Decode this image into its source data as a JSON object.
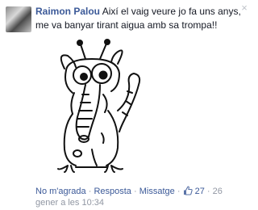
{
  "comment": {
    "author": "Raimon Palou",
    "text": "Així el vaig veure jo fa uns anys, me va banyar tirant aigua amb sa trompa!!",
    "close_symbol": "×"
  },
  "actions": {
    "unlike": "No m'agrada",
    "reply": "Resposta",
    "message": "Missatge",
    "like_count": "27",
    "date_part": "26",
    "timestamp": "gener a les 10:34",
    "separator": "·"
  },
  "icons": {
    "close": "close-icon",
    "like": "thumbs-up-icon"
  },
  "colors": {
    "link": "#3b5998",
    "meta": "#9197a3",
    "text": "#141823"
  }
}
